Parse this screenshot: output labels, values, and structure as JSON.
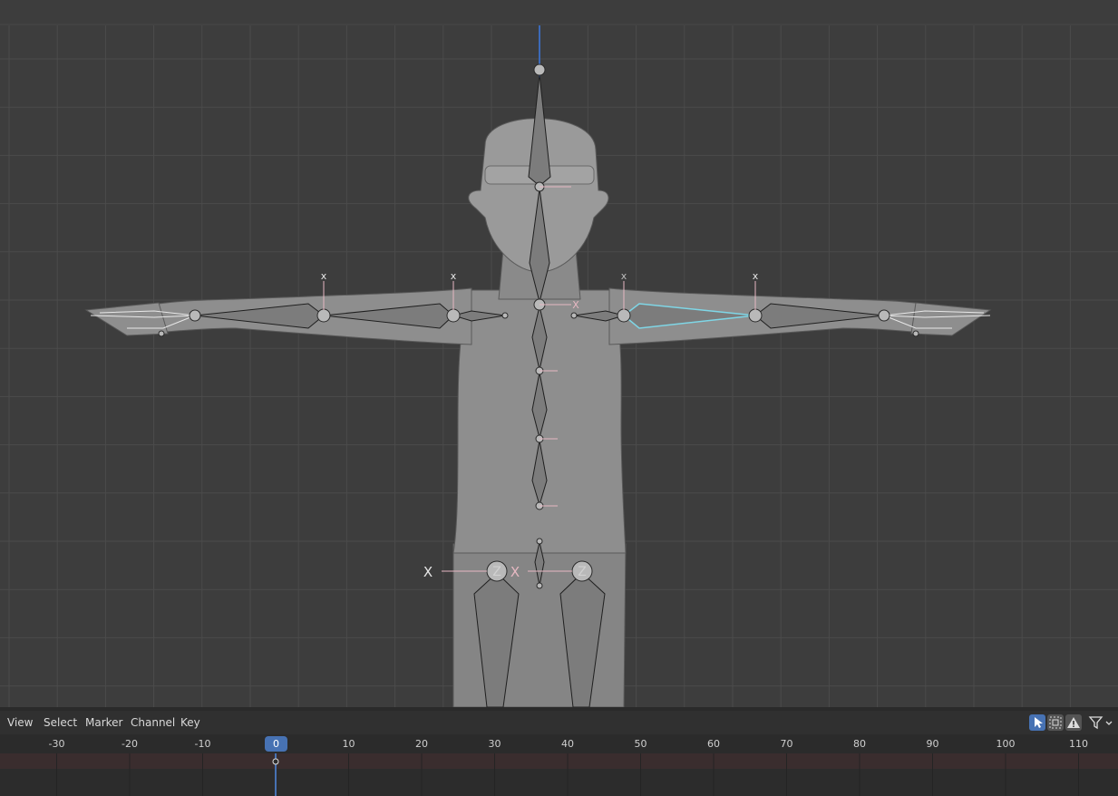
{
  "dopesheet": {
    "menus": [
      "View",
      "Select",
      "Marker",
      "Channel",
      "Key"
    ],
    "current_frame": "0",
    "frame_ticks": [
      "-30",
      "-20",
      "-10",
      "10",
      "20",
      "30",
      "40",
      "50",
      "60",
      "70",
      "80",
      "90",
      "100",
      "110"
    ]
  },
  "viewport": {
    "axis_labels": {
      "arm_markers": [
        "x",
        "x",
        "x",
        "x"
      ],
      "hip_x_left": "X",
      "hip_x_center": "X",
      "hip_z_left": "Z",
      "hip_z_right": "Z",
      "neck_x": "X"
    }
  },
  "colors": {
    "viewport_bg": "#3d3d3d",
    "grid": "#4a4a4a",
    "mesh": "#8f8f8f",
    "bone": "#7c7c7c",
    "selected_bone": "#7fd6e6",
    "axis_y": "#3c6ab8",
    "accent": "#4772b3"
  }
}
